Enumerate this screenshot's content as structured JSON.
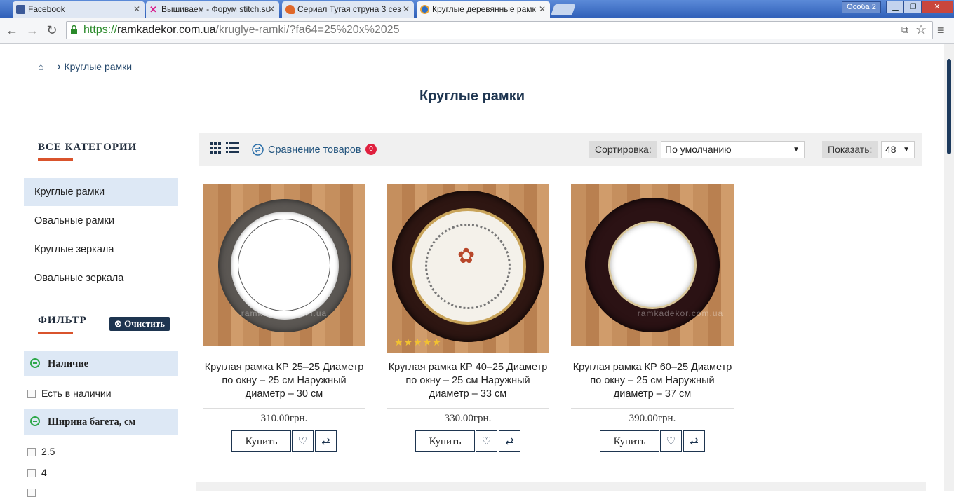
{
  "browser": {
    "tabs": [
      {
        "title": "Facebook"
      },
      {
        "title": "Вышиваем - Форум stitch.su"
      },
      {
        "title": "Сериал Тугая струна 3 сез"
      },
      {
        "title": "Круглые деревянные рамк"
      }
    ],
    "profile": "Особа 2",
    "url": {
      "scheme": "https://",
      "host": "ramkadekor.com.ua",
      "path": "/kruglye-ramki/?fa64=25%20x%2025"
    }
  },
  "breadcrumb": {
    "current": "Круглые рамки"
  },
  "page_title": "Круглые рамки",
  "sidebar": {
    "categories_heading": "ВСЕ КАТЕГОРИИ",
    "categories": [
      {
        "label": "Круглые рамки",
        "active": true
      },
      {
        "label": "Овальные рамки",
        "active": false
      },
      {
        "label": "Круглые зеркала",
        "active": false
      },
      {
        "label": "Овальные зеркала",
        "active": false
      }
    ],
    "filter_heading": "ФИЛЬТР",
    "clear_label": "Очистить",
    "groups": [
      {
        "title": "Наличие",
        "options": [
          "Есть в наличии"
        ]
      },
      {
        "title": "Ширина багета, см",
        "options": [
          "2.5",
          "4"
        ]
      }
    ]
  },
  "listing": {
    "compare_label": "Сравнение товаров",
    "compare_count": "0",
    "sort_label": "Сортировка:",
    "sort_value": "По умолчанию",
    "show_label": "Показать:",
    "show_value": "48"
  },
  "products": [
    {
      "name": "Круглая рамка КР 25–25 Диаметр по окну – 25 см Наружный диаметр – 30 см",
      "price": "310.00грн.",
      "buy": "Купить",
      "rating": 0,
      "frame_color": "#5b5753",
      "watermark": "ramkadekor.com.ua"
    },
    {
      "name": "Круглая рамка КР 40–25 Диаметр по окну – 25 см Наружный диаметр – 33 см",
      "price": "330.00грн.",
      "buy": "Купить",
      "rating": 5,
      "frame_color": "#2e1612",
      "watermark": ""
    },
    {
      "name": "Круглая рамка КР 60–25 Диаметр по окну – 25 см Наружный диаметр – 37 см",
      "price": "390.00грн.",
      "buy": "Купить",
      "rating": 0,
      "frame_color": "#2b1214",
      "watermark": "ramkadekor.com.ua"
    }
  ]
}
